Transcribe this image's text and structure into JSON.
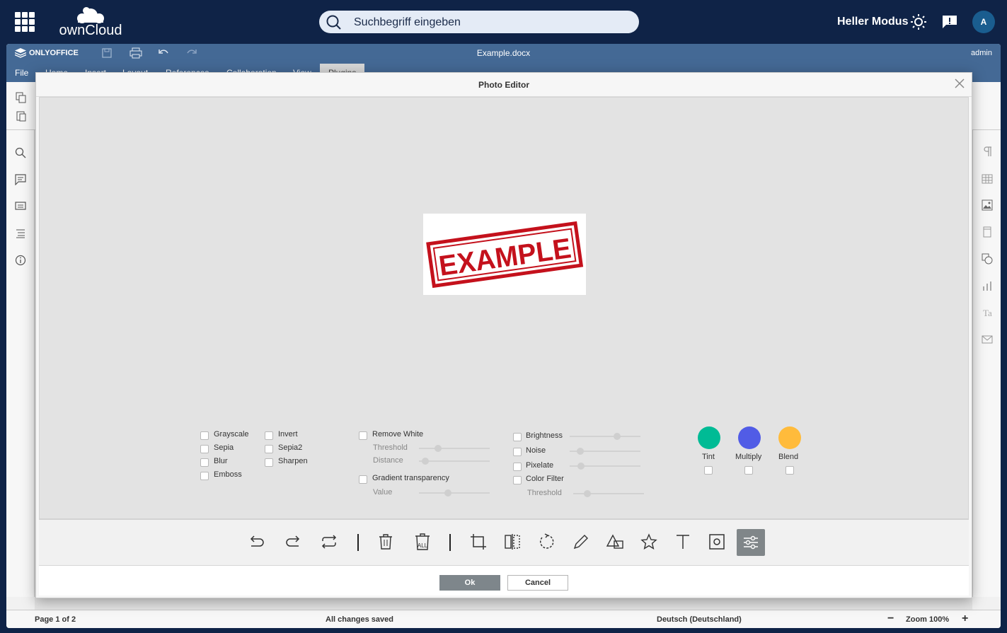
{
  "owncloud": {
    "logo_text": "ownCloud",
    "search_placeholder": "Suchbegriff eingeben",
    "mode_label": "Heller Modus",
    "avatar_initial": "A"
  },
  "onlyoffice": {
    "brand": "ONLYOFFICE",
    "doc_title": "Example.docx",
    "user": "admin",
    "tabs": [
      "File",
      "Home",
      "Insert",
      "Layout",
      "References",
      "Collaboration",
      "View",
      "Plugins"
    ],
    "active_tab": "Plugins"
  },
  "status": {
    "page": "Page 1 of 2",
    "saved": "All changes saved",
    "language": "Deutsch (Deutschland)",
    "zoom": "Zoom 100%"
  },
  "dialog": {
    "title": "Photo Editor",
    "image_text": "EXAMPLE",
    "filters_col1": [
      "Grayscale",
      "Sepia",
      "Blur",
      "Emboss"
    ],
    "filters_col2": [
      "Invert",
      "Sepia2",
      "Sharpen"
    ],
    "remove_white": "Remove White",
    "threshold": "Threshold",
    "distance": "Distance",
    "gradient": "Gradient transparency",
    "value": "Value",
    "brightness": "Brightness",
    "noise": "Noise",
    "pixelate": "Pixelate",
    "color_filter": "Color Filter",
    "threshold2": "Threshold",
    "tint": "Tint",
    "multiply": "Multiply",
    "blend": "Blend",
    "colors": {
      "tint": "#00bb95",
      "multiply": "#515ce6",
      "blend": "#ffbb3b"
    },
    "ok": "Ok",
    "cancel": "Cancel"
  }
}
